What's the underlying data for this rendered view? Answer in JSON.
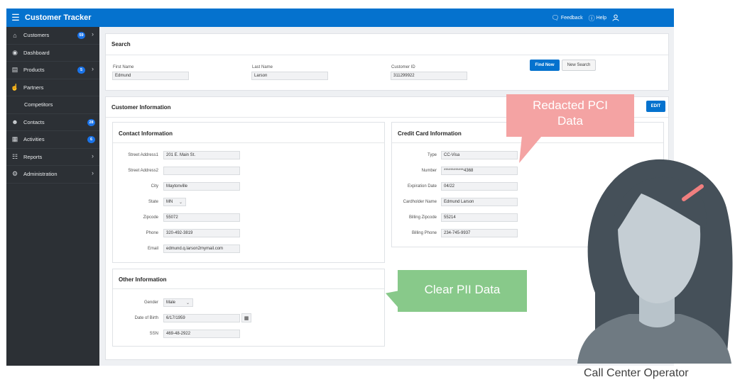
{
  "app": {
    "title": "Customer Tracker",
    "topbar": {
      "feedback": "Feedback",
      "help": "Help",
      "user": ""
    }
  },
  "sidebar": {
    "items": [
      {
        "label": "Customers",
        "icon": "home-icon",
        "badge": "59",
        "chevron": true
      },
      {
        "label": "Dashboard",
        "icon": "dashboard-icon",
        "badge": "",
        "chevron": false
      },
      {
        "label": "Products",
        "icon": "products-icon",
        "badge": "5",
        "chevron": true
      },
      {
        "label": "Partners",
        "icon": "handshake-icon",
        "badge": "",
        "chevron": false
      },
      {
        "label": "Competitors",
        "icon": "",
        "badge": "",
        "chevron": false
      },
      {
        "label": "Contacts",
        "icon": "user-icon",
        "badge": "28",
        "chevron": false
      },
      {
        "label": "Activities",
        "icon": "calendar-icon",
        "badge": "6",
        "chevron": false
      },
      {
        "label": "Reports",
        "icon": "report-icon",
        "badge": "",
        "chevron": true
      },
      {
        "label": "Administration",
        "icon": "gear-icon",
        "badge": "",
        "chevron": true
      }
    ]
  },
  "search": {
    "title": "Search",
    "first_name_label": "First Name",
    "first_name_value": "Edmund",
    "last_name_label": "Last Name",
    "last_name_value": "Larson",
    "customer_id_label": "Customer ID",
    "customer_id_value": "311299922",
    "find_now": "Find Now",
    "new_search": "New Search"
  },
  "customer_info": {
    "title": "Customer Information",
    "edit": "EDIT"
  },
  "contact": {
    "title": "Contact Information",
    "street1_label": "Street Address1",
    "street1_value": "201 E. Main St.",
    "street2_label": "Street Address2",
    "street2_value": "",
    "city_label": "City",
    "city_value": "Maytonville",
    "state_label": "State",
    "state_value": "MN",
    "zip_label": "Zipcode",
    "zip_value": "55072",
    "phone_label": "Phone",
    "phone_value": "320-492-3819",
    "email_label": "Email",
    "email_value": "edmund.q.larson2mymail.com"
  },
  "credit_card": {
    "title": "Credit Card Information",
    "type_label": "Type",
    "type_value": "CC-Visa",
    "number_label": "Number",
    "number_value": "************4368",
    "exp_label": "Expiration Date",
    "exp_value": "04/22",
    "holder_label": "Cardholder Name",
    "holder_value": "Edmund Larson",
    "bzip_label": "Billing Zipcode",
    "bzip_value": "55214",
    "bphone_label": "Billing Phone",
    "bphone_value": "234-745-9937"
  },
  "other": {
    "title": "Other Information",
    "gender_label": "Gender",
    "gender_value": "Male",
    "dob_label": "Date of Birth",
    "dob_value": "6/17/1959",
    "ssn_label": "SSN",
    "ssn_value": "469-48-2922"
  },
  "annotations": {
    "pci_line1": "Redacted PCI",
    "pci_line2": "Data",
    "pii": "Clear PII Data",
    "persona_caption": "Call Center Operator"
  },
  "colors": {
    "brand_blue": "#0572ce",
    "sidebar_bg": "#2c3035",
    "pci_callout": "#f4a3a3",
    "pii_callout": "#88c98a"
  }
}
